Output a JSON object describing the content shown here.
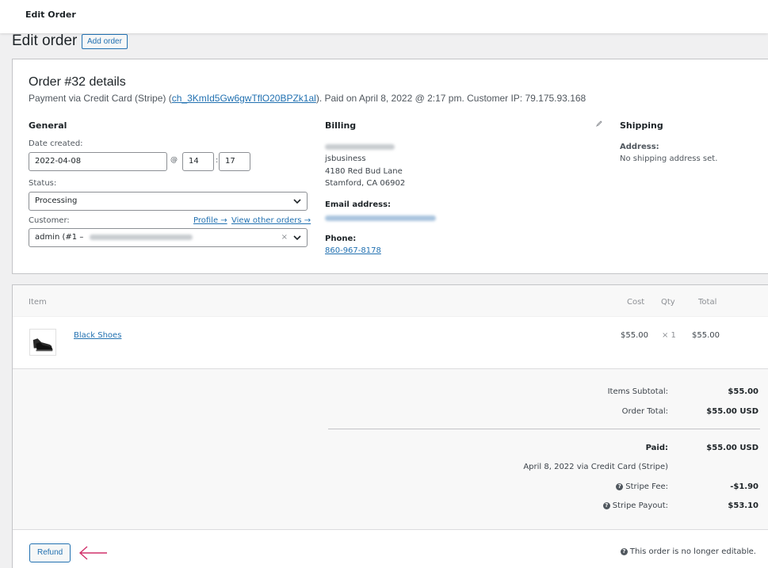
{
  "topbar": {
    "title": "Edit Order"
  },
  "page": {
    "heading": "Edit order",
    "add_order_label": "Add order"
  },
  "order": {
    "title": "Order #32 details",
    "meta_prefix": "Payment via Credit Card (Stripe) (",
    "charge_id": "ch_3KmId5Gw6gwTflO20BPZk1al",
    "meta_suffix": "). Paid on April 8, 2022 @ 2:17 pm. Customer IP: 79.175.93.168"
  },
  "general": {
    "heading": "General",
    "date_label": "Date created:",
    "date_value": "2022-04-08",
    "at_symbol": "@",
    "hour": "14",
    "colon": ":",
    "minute": "17",
    "status_label": "Status:",
    "status_value": "Processing",
    "customer_label": "Customer:",
    "profile_link": "Profile →",
    "view_orders_link": "View other orders →",
    "customer_value": "admin (#1 –",
    "clear_symbol": "×"
  },
  "billing": {
    "heading": "Billing",
    "company": "jsbusiness",
    "address1": "4180 Red Bud Lane",
    "address2": "Stamford, CA 06902",
    "email_label": "Email address:",
    "phone_label": "Phone:",
    "phone_value": "860-967-8178"
  },
  "shipping": {
    "heading": "Shipping",
    "address_label": "Address:",
    "address_value": "No shipping address set."
  },
  "items_table": {
    "headers": {
      "item": "Item",
      "cost": "Cost",
      "qty": "Qty",
      "total": "Total"
    },
    "rows": [
      {
        "name": "Black Shoes",
        "cost": "$55.00",
        "qty": "× 1",
        "total": "$55.00"
      }
    ]
  },
  "totals": {
    "items_subtotal_label": "Items Subtotal:",
    "items_subtotal_value": "$55.00",
    "order_total_label": "Order Total:",
    "order_total_value": "$55.00 USD",
    "paid_label": "Paid:",
    "paid_value": "$55.00 USD",
    "paid_note": "April 8, 2022 via Credit Card (Stripe)",
    "stripe_fee_label": "Stripe Fee:",
    "stripe_fee_value": "-$1.90",
    "stripe_payout_label": "Stripe Payout:",
    "stripe_payout_value": "$53.10",
    "help_icon": "?"
  },
  "footer": {
    "refund_label": "Refund",
    "not_editable": "This order is no longer editable."
  },
  "colors": {
    "accent": "#2271b1",
    "arrow": "#d1306a"
  }
}
